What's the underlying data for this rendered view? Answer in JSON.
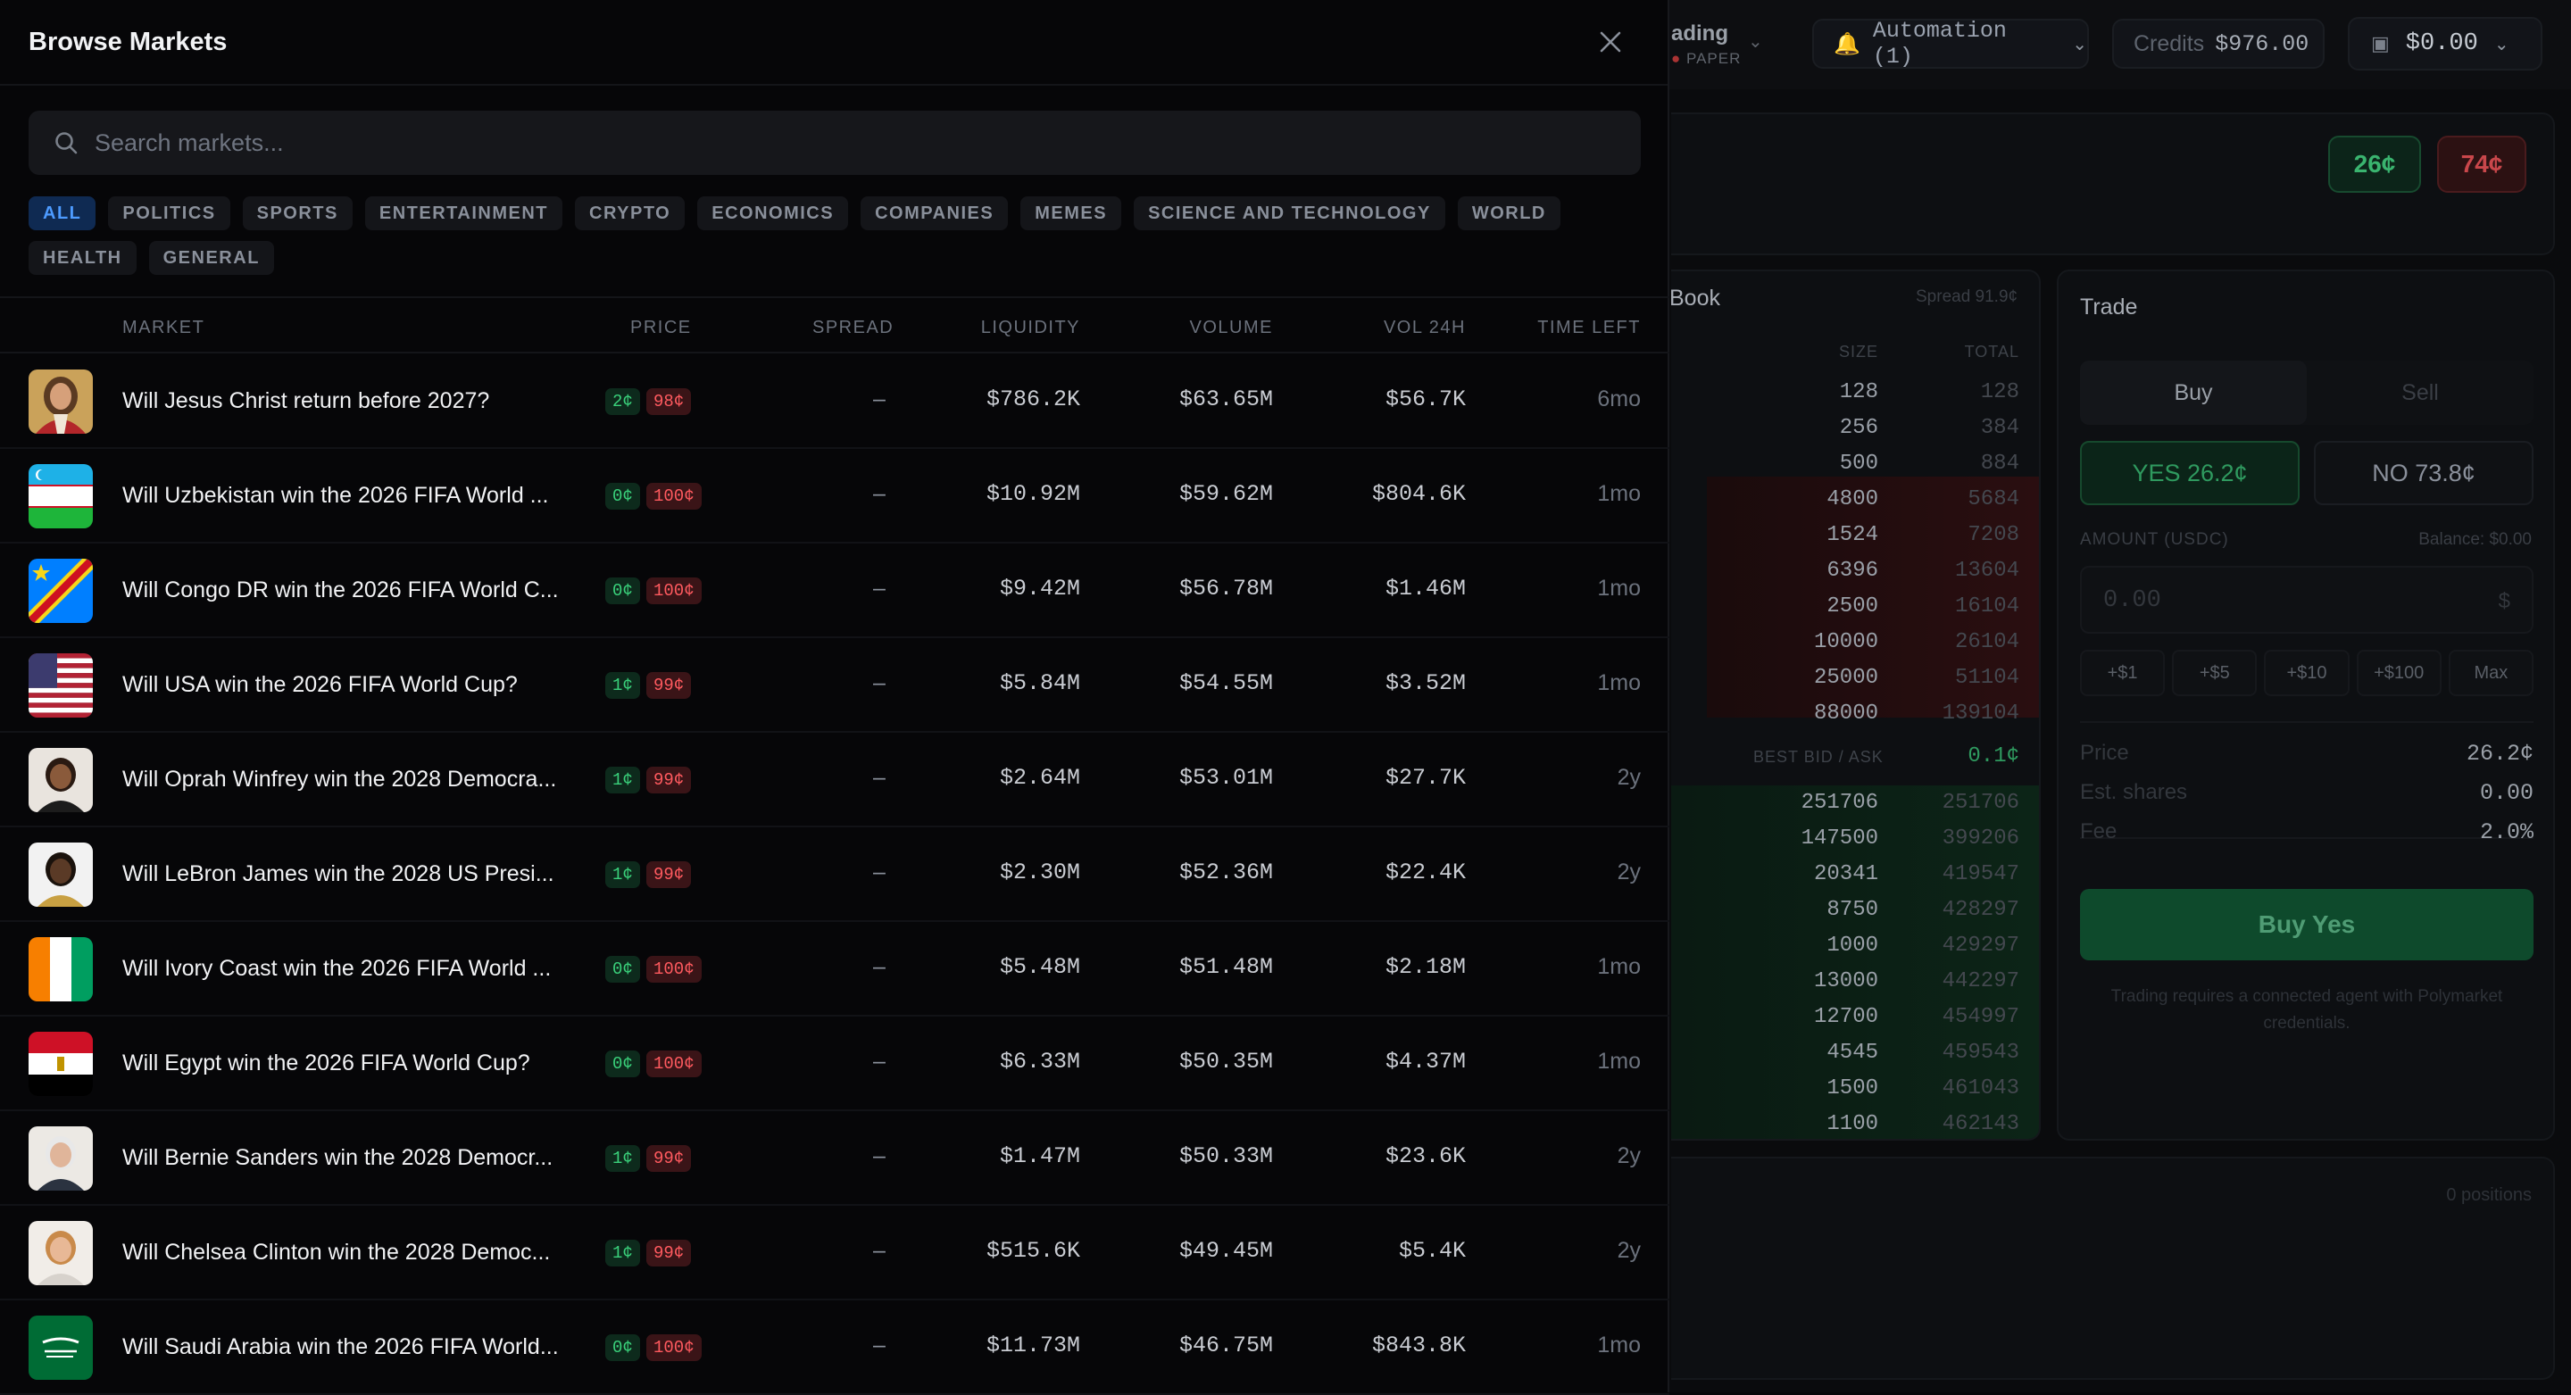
{
  "header": {
    "trading_partial": "ading",
    "mode_badge": "PAPER",
    "automation_label": "Automation (1)",
    "credits_label": "Credits",
    "credits_value": "$976.00",
    "wallet_value": "$0.00"
  },
  "market_prices": {
    "yes": "26¢",
    "no": "74¢"
  },
  "orderbook": {
    "title": "Book",
    "spread": "Spread 91.9¢",
    "col_size": "SIZE",
    "col_total": "TOTAL",
    "asks": [
      {
        "size": "128",
        "total": "128"
      },
      {
        "size": "256",
        "total": "384"
      },
      {
        "size": "500",
        "total": "884"
      },
      {
        "size": "4800",
        "total": "5684"
      },
      {
        "size": "1524",
        "total": "7208"
      },
      {
        "size": "6396",
        "total": "13604"
      },
      {
        "size": "2500",
        "total": "16104"
      },
      {
        "size": "10000",
        "total": "26104"
      },
      {
        "size": "25000",
        "total": "51104"
      },
      {
        "size": "88000",
        "total": "139104"
      }
    ],
    "mid_label": "BEST BID / ASK",
    "mid_value": "0.1¢",
    "bids": [
      {
        "size": "251706",
        "total": "251706"
      },
      {
        "size": "147500",
        "total": "399206"
      },
      {
        "size": "20341",
        "total": "419547"
      },
      {
        "size": "8750",
        "total": "428297"
      },
      {
        "size": "1000",
        "total": "429297"
      },
      {
        "size": "13000",
        "total": "442297"
      },
      {
        "size": "12700",
        "total": "454997"
      },
      {
        "size": "4545",
        "total": "459543"
      },
      {
        "size": "1500",
        "total": "461043"
      },
      {
        "size": "1100",
        "total": "462143"
      }
    ]
  },
  "trade": {
    "title": "Trade",
    "buy_tab": "Buy",
    "sell_tab": "Sell",
    "yes_option": "YES 26.2¢",
    "no_option": "NO 73.8¢",
    "amount_label": "AMOUNT (USDC)",
    "balance_label": "Balance: $0.00",
    "amount_placeholder": "0.00",
    "currency": "$",
    "quick": [
      "+$1",
      "+$5",
      "+$10",
      "+$100",
      "Max"
    ],
    "price_label": "Price",
    "price_value": "26.2¢",
    "shares_label": "Est. shares",
    "shares_value": "0.00",
    "fee_label": "Fee",
    "fee_value": "2.0%",
    "buy_button": "Buy Yes",
    "notice": "Trading requires a connected agent with Polymarket credentials."
  },
  "positions": {
    "count_label": "0 positions"
  },
  "modal": {
    "title": "Browse Markets",
    "search_placeholder": "Search markets...",
    "categories": [
      "ALL",
      "POLITICS",
      "SPORTS",
      "ENTERTAINMENT",
      "CRYPTO",
      "ECONOMICS",
      "COMPANIES",
      "MEMES",
      "SCIENCE AND TECHNOLOGY",
      "WORLD",
      "HEALTH",
      "GENERAL"
    ],
    "columns": {
      "market": "MARKET",
      "price": "PRICE",
      "spread": "SPREAD",
      "liquidity": "LIQUIDITY",
      "volume": "VOLUME",
      "vol24h": "VOL 24H",
      "time_left": "TIME LEFT"
    },
    "rows": [
      {
        "name": "Will Jesus Christ return before 2027?",
        "yes": "2¢",
        "no": "98¢",
        "spread": "–",
        "liquidity": "$786.2K",
        "volume": "$63.65M",
        "vol24h": "$56.7K",
        "time_left": "6mo",
        "image": "jesus-portrait"
      },
      {
        "name": "Will Uzbekistan win the 2026 FIFA World ...",
        "yes": "0¢",
        "no": "100¢",
        "spread": "–",
        "liquidity": "$10.92M",
        "volume": "$59.62M",
        "vol24h": "$804.6K",
        "time_left": "1mo",
        "image": "uzbekistan-flag"
      },
      {
        "name": "Will Congo DR win the 2026 FIFA World C...",
        "yes": "0¢",
        "no": "100¢",
        "spread": "–",
        "liquidity": "$9.42M",
        "volume": "$56.78M",
        "vol24h": "$1.46M",
        "time_left": "1mo",
        "image": "congo-flag"
      },
      {
        "name": "Will USA win the 2026 FIFA World Cup?",
        "yes": "1¢",
        "no": "99¢",
        "spread": "–",
        "liquidity": "$5.84M",
        "volume": "$54.55M",
        "vol24h": "$3.52M",
        "time_left": "1mo",
        "image": "usa-flag"
      },
      {
        "name": "Will Oprah Winfrey win the 2028 Democra...",
        "yes": "1¢",
        "no": "99¢",
        "spread": "–",
        "liquidity": "$2.64M",
        "volume": "$53.01M",
        "vol24h": "$27.7K",
        "time_left": "2y",
        "image": "oprah-portrait"
      },
      {
        "name": "Will LeBron James win the 2028 US Presi...",
        "yes": "1¢",
        "no": "99¢",
        "spread": "–",
        "liquidity": "$2.30M",
        "volume": "$52.36M",
        "vol24h": "$22.4K",
        "time_left": "2y",
        "image": "lebron-portrait"
      },
      {
        "name": "Will Ivory Coast win the 2026 FIFA World ...",
        "yes": "0¢",
        "no": "100¢",
        "spread": "–",
        "liquidity": "$5.48M",
        "volume": "$51.48M",
        "vol24h": "$2.18M",
        "time_left": "1mo",
        "image": "ivory-coast-flag"
      },
      {
        "name": "Will Egypt win the 2026 FIFA World Cup?",
        "yes": "0¢",
        "no": "100¢",
        "spread": "–",
        "liquidity": "$6.33M",
        "volume": "$50.35M",
        "vol24h": "$4.37M",
        "time_left": "1mo",
        "image": "egypt-flag"
      },
      {
        "name": "Will Bernie Sanders win the 2028 Democr...",
        "yes": "1¢",
        "no": "99¢",
        "spread": "–",
        "liquidity": "$1.47M",
        "volume": "$50.33M",
        "vol24h": "$23.6K",
        "time_left": "2y",
        "image": "bernie-portrait"
      },
      {
        "name": "Will Chelsea Clinton win the 2028 Democ...",
        "yes": "1¢",
        "no": "99¢",
        "spread": "–",
        "liquidity": "$515.6K",
        "volume": "$49.45M",
        "vol24h": "$5.4K",
        "time_left": "2y",
        "image": "chelsea-portrait"
      },
      {
        "name": "Will Saudi Arabia win the 2026 FIFA World...",
        "yes": "0¢",
        "no": "100¢",
        "spread": "–",
        "liquidity": "$11.73M",
        "volume": "$46.75M",
        "vol24h": "$843.8K",
        "time_left": "1mo",
        "image": "saudi-flag"
      }
    ]
  }
}
